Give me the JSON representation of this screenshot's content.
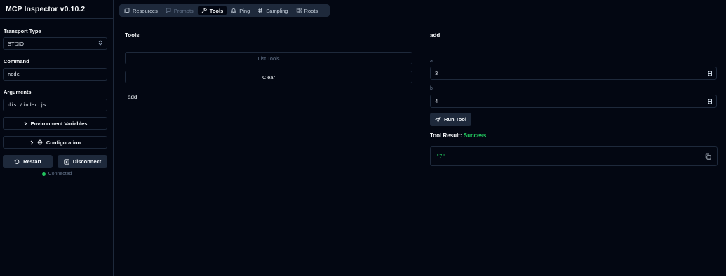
{
  "app": {
    "title": "MCP Inspector v0.10.2"
  },
  "sidebar": {
    "transport_label": "Transport Type",
    "transport_value": "STDIO",
    "command_label": "Command",
    "command_value": "node",
    "arguments_label": "Arguments",
    "arguments_value": "dist/index.js",
    "env_button": "Environment Variables",
    "config_button": "Configuration",
    "restart_button": "Restart",
    "disconnect_button": "Disconnect",
    "status_text": "Connected",
    "status_color": "#22c55e"
  },
  "tabs": [
    {
      "label": "Resources",
      "icon": "files-icon",
      "state": "normal"
    },
    {
      "label": "Prompts",
      "icon": "message-square-icon",
      "state": "disabled"
    },
    {
      "label": "Tools",
      "icon": "hammer-icon",
      "state": "active"
    },
    {
      "label": "Ping",
      "icon": "bell-icon",
      "state": "normal"
    },
    {
      "label": "Sampling",
      "icon": "hash-icon",
      "state": "normal"
    },
    {
      "label": "Roots",
      "icon": "folder-tree-icon",
      "state": "normal"
    }
  ],
  "tools_panel": {
    "title": "Tools",
    "list_button": "List Tools",
    "clear_button": "Clear",
    "items": [
      "add"
    ]
  },
  "tool_detail": {
    "title": "add",
    "params": [
      {
        "name": "a",
        "value": "3"
      },
      {
        "name": "b",
        "value": "4"
      }
    ],
    "run_button": "Run Tool",
    "result_label": "Tool Result:",
    "result_status": "Success",
    "result_value": "\"7\""
  }
}
